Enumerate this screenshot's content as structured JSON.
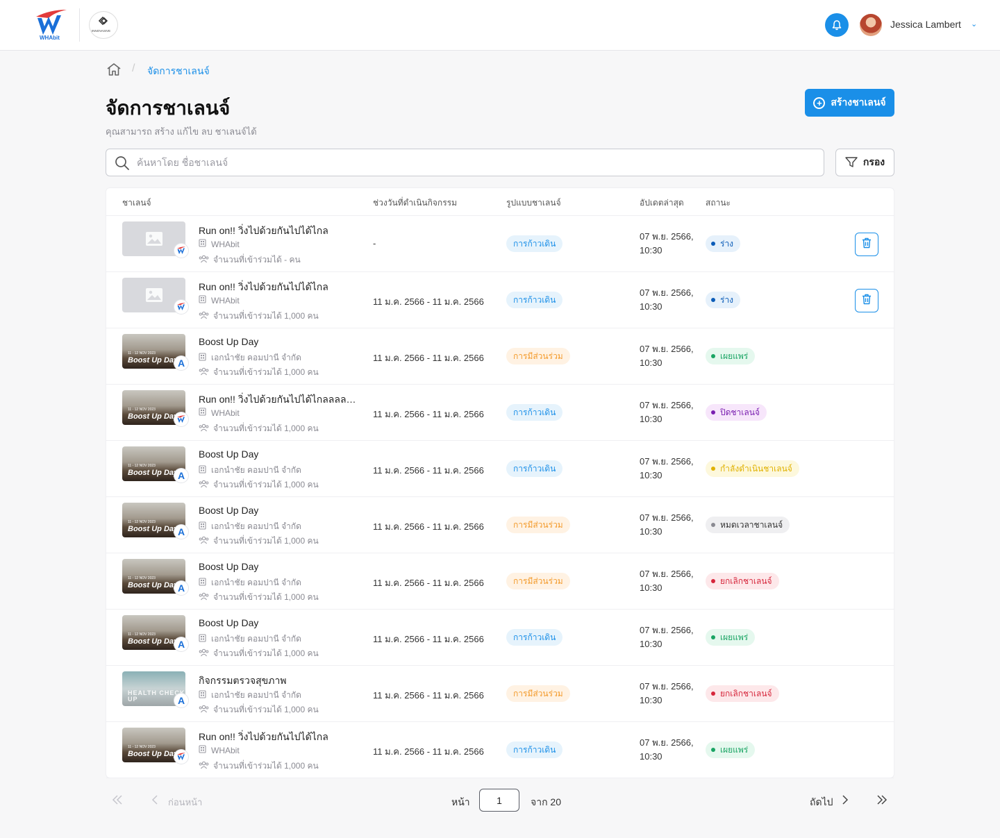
{
  "header": {
    "logo_text": "WHAbit",
    "partner_logo_text": "INNOVASIVE",
    "user_name": "Jessica Lambert"
  },
  "breadcrumb": {
    "current": "จัดการชาเลนจ์"
  },
  "page": {
    "title": "จัดการชาเลนจ์",
    "subtitle": "คุณสามารถ สร้าง แก้ไข ลบ ชาเลนจ์ได้",
    "create_label": "สร้างชาเลนจ์",
    "filter_label": "กรอง"
  },
  "search": {
    "placeholder": "ค้นหาโดย ชื่อชาเลนจ์",
    "value": ""
  },
  "table": {
    "headers": [
      "ชาเลนจ์",
      "ช่วงวันที่ดำเนินกิจกรรม",
      "รูปแบบชาเลนจ์",
      "อัปเดตล่าสุด",
      "สถานะ"
    ],
    "rows": [
      {
        "thumb": "placeholder",
        "badge": "W",
        "title": "Run on!! วิ่งไปด้วยกันไปได้ไกล",
        "org": "WHAbit",
        "capacity": "จำนวนที่เข้าร่วมได้ - คน",
        "date_range": "-",
        "type": "การก้าวเดิน",
        "type_color": "blue",
        "updated_date": "07 พ.ย. 2566,",
        "updated_time": "10:30",
        "status": "ร่าง",
        "status_color": "#0b5cb8",
        "status_bg": "#e6f1fb",
        "deletable": true
      },
      {
        "thumb": "placeholder",
        "badge": "W",
        "title": "Run on!! วิ่งไปด้วยกันไปได้ไกล",
        "org": "WHAbit",
        "capacity": "จำนวนที่เข้าร่วมได้ 1,000 คน",
        "date_range": "11 ม.ค. 2566 - 11 ม.ค. 2566",
        "type": "การก้าวเดิน",
        "type_color": "blue",
        "updated_date": "07 พ.ย. 2566,",
        "updated_time": "10:30",
        "status": "ร่าง",
        "status_color": "#0b5cb8",
        "status_bg": "#e6f1fb",
        "deletable": true
      },
      {
        "thumb": "photo",
        "photo_text": "Boost Up Day",
        "photo_date": "11 - 12 NOV 2023",
        "badge": "A",
        "title": "Boost Up Day",
        "org": "เอกนำชัย คอมปานี จำกัด",
        "capacity": "จำนวนที่เข้าร่วมได้ 1,000 คน",
        "date_range": "11 ม.ค. 2566 - 11 ม.ค. 2566",
        "type": "การมีส่วนร่วม",
        "type_color": "orange",
        "updated_date": "07 พ.ย. 2566,",
        "updated_time": "10:30",
        "status": "เผยแพร่",
        "status_color": "#19a463",
        "status_bg": "#e5f8ee",
        "deletable": false
      },
      {
        "thumb": "photo",
        "photo_text": "Boost Up Day",
        "photo_date": "11 - 12 NOV 2023",
        "badge": "W",
        "title": "Run on!!  วิ่งไปด้วยกันไปได้ไกลลลลลลลลลลล",
        "org": "WHAbit",
        "capacity": "จำนวนที่เข้าร่วมได้ 1,000 คน",
        "date_range": "11 ม.ค. 2566 - 11 ม.ค. 2566",
        "type": "การก้าวเดิน",
        "type_color": "blue",
        "updated_date": "07 พ.ย. 2566,",
        "updated_time": "10:30",
        "status": "ปิดชาเลนจ์",
        "status_color": "#7a1fb0",
        "status_bg": "#f7e6fb",
        "deletable": false
      },
      {
        "thumb": "photo",
        "photo_text": "Boost Up Day",
        "photo_date": "11 - 12 NOV 2023",
        "badge": "A",
        "title": "Boost Up Day",
        "org": "เอกนำชัย คอมปานี จำกัด",
        "capacity": "จำนวนที่เข้าร่วมได้ 1,000 คน",
        "date_range": "11 ม.ค. 2566 - 11 ม.ค. 2566",
        "type": "การก้าวเดิน",
        "type_color": "blue",
        "updated_date": "07 พ.ย. 2566,",
        "updated_time": "10:30",
        "status": "กำลังดำเนินชาเลนจ์",
        "status_color": "#e0b100",
        "status_bg": "#fdf8dc",
        "deletable": false
      },
      {
        "thumb": "photo",
        "photo_text": "Boost Up Day",
        "photo_date": "11 - 12 NOV 2023",
        "badge": "A",
        "title": "Boost Up Day",
        "org": "เอกนำชัย คอมปานี จำกัด",
        "capacity": "จำนวนที่เข้าร่วมได้ 1,000 คน",
        "date_range": "11 ม.ค. 2566 - 11 ม.ค. 2566",
        "type": "การมีส่วนร่วม",
        "type_color": "orange",
        "updated_date": "07 พ.ย. 2566,",
        "updated_time": "10:30",
        "status": "หมดเวลาชาเลนจ์",
        "status_color": "#333333",
        "status_bg": "#efeff1",
        "status_dot": "#8a8a92",
        "deletable": false
      },
      {
        "thumb": "photo",
        "photo_text": "Boost Up Day",
        "photo_date": "11 - 12 NOV 2023",
        "badge": "A",
        "title": "Boost Up Day",
        "org": "เอกนำชัย คอมปานี จำกัด",
        "capacity": "จำนวนที่เข้าร่วมได้ 1,000 คน",
        "date_range": "11 ม.ค. 2566 - 11 ม.ค. 2566",
        "type": "การมีส่วนร่วม",
        "type_color": "orange",
        "updated_date": "07 พ.ย. 2566,",
        "updated_time": "10:30",
        "status": "ยกเลิกชาเลนจ์",
        "status_color": "#d6263b",
        "status_bg": "#fde8ea",
        "deletable": false
      },
      {
        "thumb": "photo",
        "photo_text": "Boost Up Day",
        "photo_date": "11 - 12 NOV 2023",
        "badge": "A",
        "title": "Boost Up Day",
        "org": "เอกนำชัย คอมปานี จำกัด",
        "capacity": "จำนวนที่เข้าร่วมได้ 1,000 คน",
        "date_range": "11 ม.ค. 2566 - 11 ม.ค. 2566",
        "type": "การก้าวเดิน",
        "type_color": "blue",
        "updated_date": "07 พ.ย. 2566,",
        "updated_time": "10:30",
        "status": "เผยแพร่",
        "status_color": "#19a463",
        "status_bg": "#e5f8ee",
        "deletable": false
      },
      {
        "thumb": "health",
        "photo_text": "HEALTH CHECK UP",
        "badge": "A",
        "title": "กิจกรรมตรวจสุขภาพ",
        "org": "เอกนำชัย คอมปานี จำกัด",
        "capacity": "จำนวนที่เข้าร่วมได้ 1,000 คน",
        "date_range": "11 ม.ค. 2566 - 11 ม.ค. 2566",
        "type": "การมีส่วนร่วม",
        "type_color": "orange",
        "updated_date": "07 พ.ย. 2566,",
        "updated_time": "10:30",
        "status": "ยกเลิกชาเลนจ์",
        "status_color": "#d6263b",
        "status_bg": "#fde8ea",
        "deletable": false
      },
      {
        "thumb": "photo",
        "photo_text": "Boost Up Day",
        "photo_date": "11 - 12 NOV 2023",
        "badge": "W",
        "title": "Run on!! วิ่งไปด้วยกันไปได้ไกล",
        "org": "WHAbit",
        "capacity": "จำนวนที่เข้าร่วมได้ 1,000 คน",
        "date_range": "11 ม.ค. 2566 - 11 ม.ค. 2566",
        "type": "การก้าวเดิน",
        "type_color": "blue",
        "updated_date": "07 พ.ย. 2566,",
        "updated_time": "10:30",
        "status": "เผยแพร่",
        "status_color": "#19a463",
        "status_bg": "#e5f8ee",
        "deletable": false
      }
    ]
  },
  "pagination": {
    "prev_label": "ก่อนหน้า",
    "page_label": "หน้า",
    "current_page": "1",
    "of_label": "จาก 20",
    "next_label": "ถัดไป"
  },
  "colors": {
    "accent": "#1a8fe8"
  }
}
